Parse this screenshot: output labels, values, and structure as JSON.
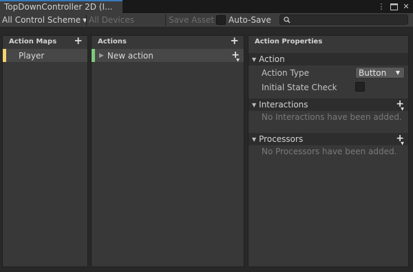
{
  "tab": {
    "title": "TopDownController 2D (I...",
    "icons": [
      "more-vert-icon",
      "maximize-icon",
      "close-icon"
    ]
  },
  "toolbar": {
    "control_scheme": "All Control Scheme",
    "devices": "All Devices",
    "save_asset": "Save Asset",
    "auto_save": "Auto-Save",
    "search_value": ""
  },
  "action_maps": {
    "header": "Action Maps",
    "items": [
      {
        "label": "Player",
        "color": "#f3d36e"
      }
    ]
  },
  "actions": {
    "header": "Actions",
    "items": [
      {
        "label": "New action",
        "color": "#7ec97b"
      }
    ]
  },
  "properties": {
    "header": "Action Properties",
    "action_section": "Action",
    "action_type_label": "Action Type",
    "action_type_value": "Button",
    "initial_state_label": "Initial State Check",
    "interactions_section": "Interactions",
    "interactions_empty": "No Interactions have been added.",
    "processors_section": "Processors",
    "processors_empty": "No Processors have been added."
  },
  "colors": {
    "tab_accent": "#3a79bb",
    "background": "#282828",
    "panel": "#383838",
    "row_selected": "#474747"
  }
}
